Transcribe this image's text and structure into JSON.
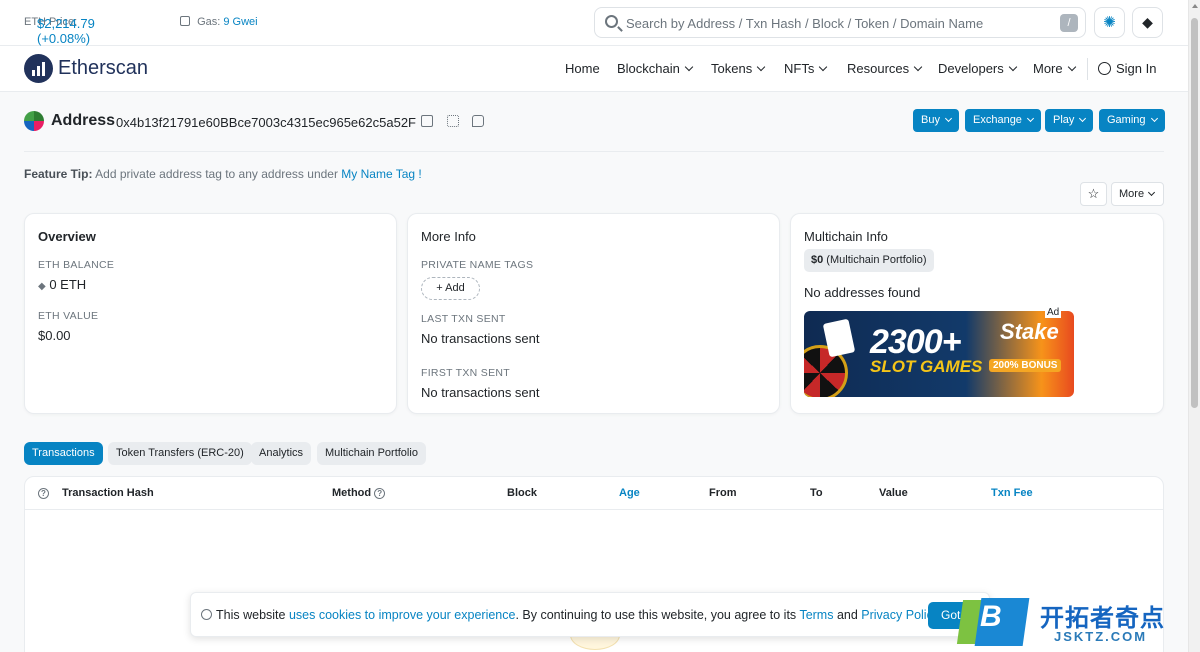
{
  "topbar": {
    "price_label": "ETH Price:",
    "price_value": "$2,214.79 (+0.08%)",
    "gas_label": "Gas:",
    "gas_value": "9 Gwei"
  },
  "search": {
    "placeholder": "Search by Address / Txn Hash / Block / Token / Domain Name",
    "shortcut": "/"
  },
  "nav": {
    "logo": "Etherscan",
    "items": [
      {
        "label": "Home"
      },
      {
        "label": "Blockchain"
      },
      {
        "label": "Tokens"
      },
      {
        "label": "NFTs"
      },
      {
        "label": "Resources"
      },
      {
        "label": "Developers"
      },
      {
        "label": "More"
      }
    ],
    "signin": "Sign In"
  },
  "address": {
    "label": "Address",
    "hash": "0x4b13f21791e60BBce7003c4315ec965e62c5a52F",
    "buttons": [
      {
        "label": "Buy"
      },
      {
        "label": "Exchange"
      },
      {
        "label": "Play"
      },
      {
        "label": "Gaming"
      }
    ]
  },
  "tip": {
    "label": "Feature Tip:",
    "text": " Add private address tag to any address under ",
    "link": "My Name Tag !"
  },
  "actions": {
    "star": "☆",
    "more": "More"
  },
  "overview": {
    "title": "Overview",
    "balance_label": "ETH BALANCE",
    "balance_value": "0 ETH",
    "value_label": "ETH VALUE",
    "value_value": "$0.00"
  },
  "more_info": {
    "title": "More Info",
    "tags_label": "PRIVATE NAME TAGS",
    "add_label": "+ Add",
    "last_label": "LAST TXN SENT",
    "last_value": "No transactions sent",
    "first_label": "FIRST TXN SENT",
    "first_value": "No transactions sent"
  },
  "multichain": {
    "title": "Multichain Info",
    "portfolio_value": "$0",
    "portfolio_label": " (Multichain Portfolio)",
    "none_text": "No addresses found",
    "ad_tag": "Ad",
    "ad_big": "2300+",
    "ad_slot": "SLOT GAMES",
    "ad_brand": "Stake",
    "ad_bonus": "200% BONUS"
  },
  "tabs": [
    {
      "label": "Transactions"
    },
    {
      "label": "Token Transfers (ERC-20)"
    },
    {
      "label": "Analytics"
    },
    {
      "label": "Multichain Portfolio"
    }
  ],
  "table": {
    "columns": [
      "Transaction Hash",
      "Method",
      "Block",
      "Age",
      "From",
      "To",
      "Value",
      "Txn Fee"
    ]
  },
  "cookie": {
    "pre": "This website ",
    "link1": "uses cookies to improve your experience",
    "mid": ". By continuing to use this website, you agree to its ",
    "link2": "Terms",
    "and": " and ",
    "link3": "Privacy Policy",
    "end": ".",
    "button": "Got it!"
  },
  "watermark": {
    "letter": "B",
    "cn": "开拓者奇点",
    "url": "JSKTZ.COM"
  },
  "colors": {
    "accent": "#0784c3",
    "brand_dark": "#21325b"
  }
}
